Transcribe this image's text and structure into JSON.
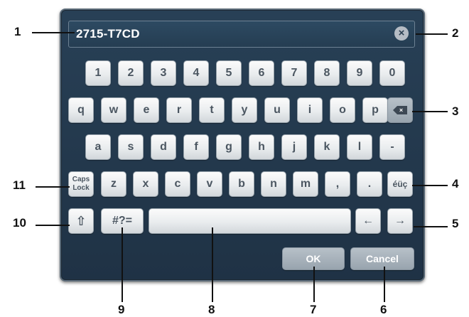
{
  "input": {
    "value": "2715-T7CD",
    "clear_icon": "clear-circle-icon"
  },
  "rows": {
    "numbers": [
      "1",
      "2",
      "3",
      "4",
      "5",
      "6",
      "7",
      "8",
      "9",
      "0"
    ],
    "row1": [
      "q",
      "w",
      "e",
      "r",
      "t",
      "y",
      "u",
      "i",
      "o",
      "p"
    ],
    "row2": [
      "a",
      "s",
      "d",
      "f",
      "g",
      "h",
      "j",
      "k",
      "l",
      "-"
    ],
    "row3": [
      "z",
      "x",
      "c",
      "v",
      "b",
      "n",
      "m",
      ",",
      "."
    ]
  },
  "keys": {
    "backspace_icon": "backspace-icon",
    "backspace_glyph": "×",
    "caps_line1": "Caps",
    "caps_line2": "Lock",
    "special_chars": "éüç",
    "shift_glyph": "⇧",
    "symbols": "#?=",
    "arrow_left": "←",
    "arrow_right": "→",
    "ok": "OK",
    "cancel": "Cancel"
  },
  "callouts": [
    "1",
    "2",
    "3",
    "4",
    "5",
    "6",
    "7",
    "8",
    "9",
    "10",
    "11"
  ]
}
